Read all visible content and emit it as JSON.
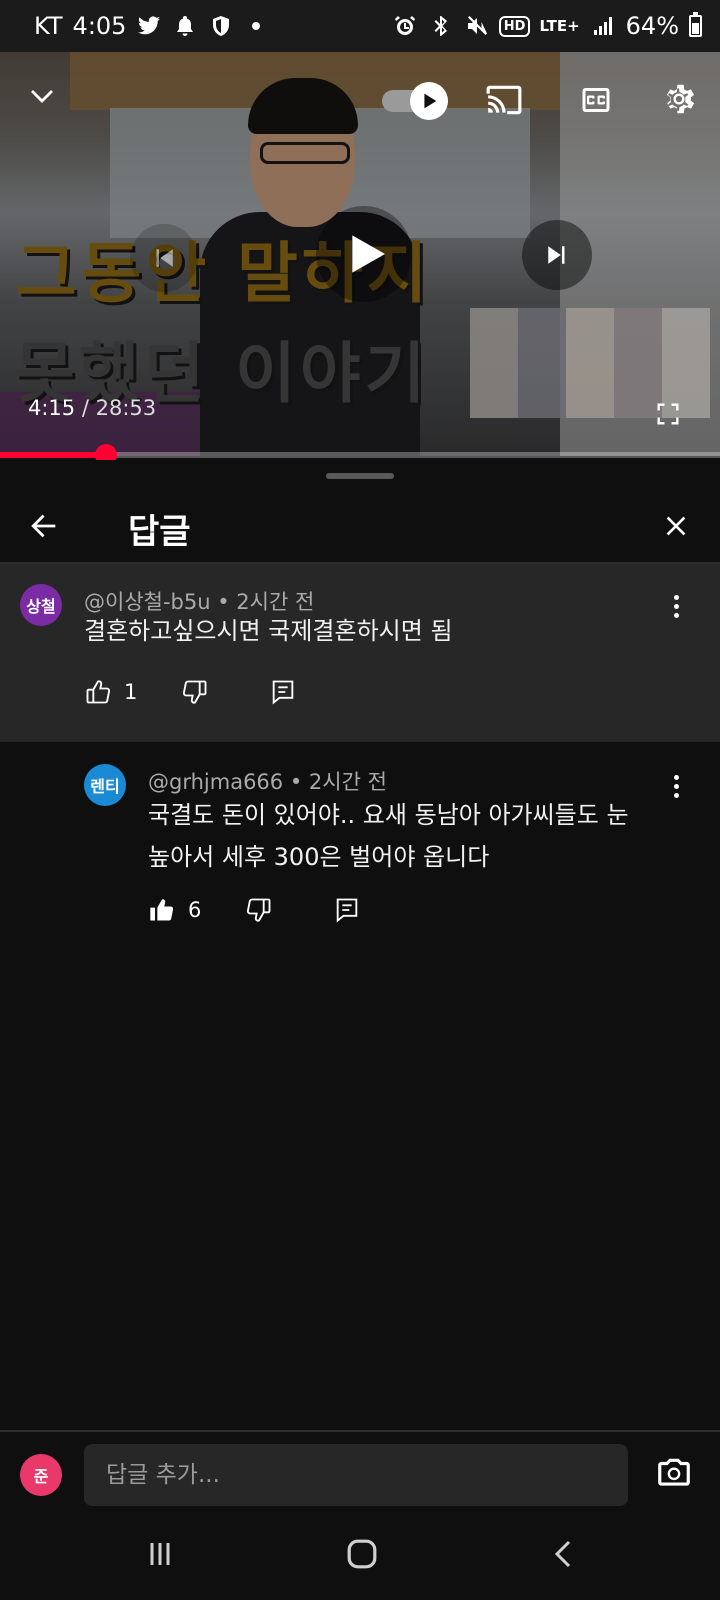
{
  "status_bar": {
    "carrier": "KT",
    "time": "4:05",
    "left_icons": [
      "twitter-icon",
      "bell-icon",
      "shield-icon"
    ],
    "right_icons": [
      "alarm-icon",
      "bluetooth-icon",
      "mute-icon",
      "hd-icon",
      "lte-icon",
      "signal-icon"
    ],
    "network_label": "LTE+",
    "hd_label": "HD",
    "battery": "64%"
  },
  "video": {
    "overlay_title_line1": "그동안 말하지",
    "overlay_title_line2": "못했던 이야기",
    "current_time": "4:15",
    "separator": " / ",
    "duration": "28:53",
    "progress_fraction": 0.147,
    "autoplay": true,
    "state": "paused",
    "accent_color": "#ff0033"
  },
  "panel": {
    "title": "답글",
    "back_icon": "arrow-left-icon",
    "close_icon": "close-icon"
  },
  "parent_comment": {
    "avatar_text": "상철",
    "avatar_color": "#7b2ba4",
    "author": "@이상철-b5u",
    "time": "2시간 전",
    "text": "결혼하고싶으시면 국제결혼하시면 됨",
    "likes": "1",
    "liked": false
  },
  "reply_comment": {
    "avatar_text": "렌티",
    "avatar_color": "#1a8ad4",
    "author": "@grhjma666",
    "time": "2시간 전",
    "text_line1": "국결도 돈이 있어야.. 요새 동남아 아가씨들도 눈",
    "text_line2": "높아서 세후 300은 벌어야 옵니다",
    "likes": "6",
    "liked": true
  },
  "input": {
    "avatar_text": "준",
    "avatar_color": "#e8396a",
    "placeholder": "답글 추가...",
    "camera_icon": "camera-icon"
  },
  "navbar": {
    "buttons": [
      "recents-icon",
      "home-icon",
      "back-icon"
    ]
  }
}
